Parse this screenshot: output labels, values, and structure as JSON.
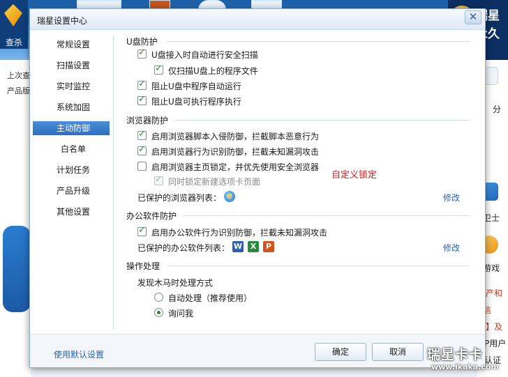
{
  "background": {
    "logo_label": "查杀",
    "brand_line1": "瑞星",
    "brand_line2": "永久",
    "left_texts": [
      "上次查",
      "产品版"
    ],
    "right_texts": [
      "分",
      "卫士",
      "游戏",
      "财产和",
      "信",
      "务】及",
      "P用户",
      "认证"
    ]
  },
  "watermark": {
    "title": "瑞星卡卡",
    "url": "www.ikaka.com"
  },
  "dialog": {
    "title": "瑞星设置中心",
    "close_glyph": "✕"
  },
  "sidebar": {
    "items": [
      {
        "label": "常规设置",
        "active": false
      },
      {
        "label": "扫描设置",
        "active": false
      },
      {
        "label": "实时监控",
        "active": false
      },
      {
        "label": "系统加固",
        "active": false
      },
      {
        "label": "主动防御",
        "active": true
      },
      {
        "label": "白名单",
        "active": false
      },
      {
        "label": "计划任务",
        "active": false
      },
      {
        "label": "产品升级",
        "active": false
      },
      {
        "label": "其他设置",
        "active": false
      }
    ]
  },
  "usb": {
    "title": "U盘防护",
    "opt_autoscan": "U盘接入时自动进行安全扫描",
    "opt_only_programs": "仅扫描U盘上的程序文件",
    "opt_block_autorun": "阻止U盘中程序自动运行",
    "opt_block_exec": "阻止U盘可执行程序执行"
  },
  "browser": {
    "title": "浏览器防护",
    "opt_script": "启用浏览器脚本入侵防御，拦截脚本恶意行为",
    "opt_behavior": "启用浏览器行为识别防御，拦截未知漏洞攻击",
    "opt_homepage": "启用浏览器主页锁定，并优先使用安全浏览器",
    "opt_newtab": "同时锁定新建选项卡页面",
    "custom_lock_note": "自定义锁定",
    "protected_label": "已保护的浏览器列表：",
    "modify": "修改"
  },
  "office": {
    "title": "办公软件防护",
    "opt_behavior": "启用办公软件行为识别防御，拦截未知漏洞攻击",
    "protected_label": "已保护的办公软件列表：",
    "icons": [
      "W",
      "X",
      "P"
    ],
    "modify": "修改"
  },
  "action": {
    "title": "操作处理",
    "subtitle": "发现木马时处理方式",
    "opt_auto": "自动处理（推荐使用）",
    "opt_ask": "询问我"
  },
  "footer": {
    "default_link": "使用默认设置",
    "ok": "确定",
    "cancel": "取消"
  }
}
